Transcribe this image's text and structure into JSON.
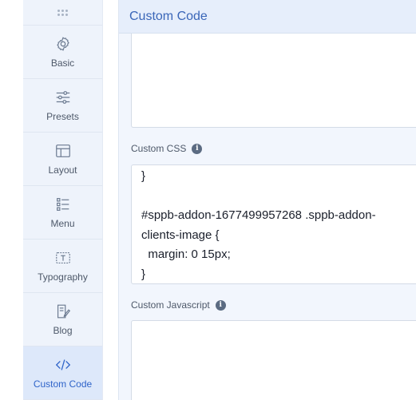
{
  "sidebar": {
    "items": [
      {
        "label": "Basic",
        "icon": "gear-icon"
      },
      {
        "label": "Presets",
        "icon": "sliders-icon"
      },
      {
        "label": "Layout",
        "icon": "layout-icon"
      },
      {
        "label": "Menu",
        "icon": "menu-list-icon"
      },
      {
        "label": "Typography",
        "icon": "typography-icon"
      },
      {
        "label": "Blog",
        "icon": "blog-edit-icon"
      },
      {
        "label": "Custom Code",
        "icon": "code-icon",
        "active": true
      }
    ]
  },
  "panel": {
    "title": "Custom Code",
    "custom_css_label": "Custom CSS",
    "custom_css_value": "}\n\n#sppb-addon-1677499957268 .sppb-addon-clients-image {\n  margin: 0 15px;\n}",
    "custom_js_label": "Custom Javascript",
    "custom_js_value": "",
    "info_glyph": "i"
  },
  "colors": {
    "accent": "#2f64c9",
    "sidebar_bg": "#eef3fb",
    "panel_bg": "#f2f6fd"
  }
}
